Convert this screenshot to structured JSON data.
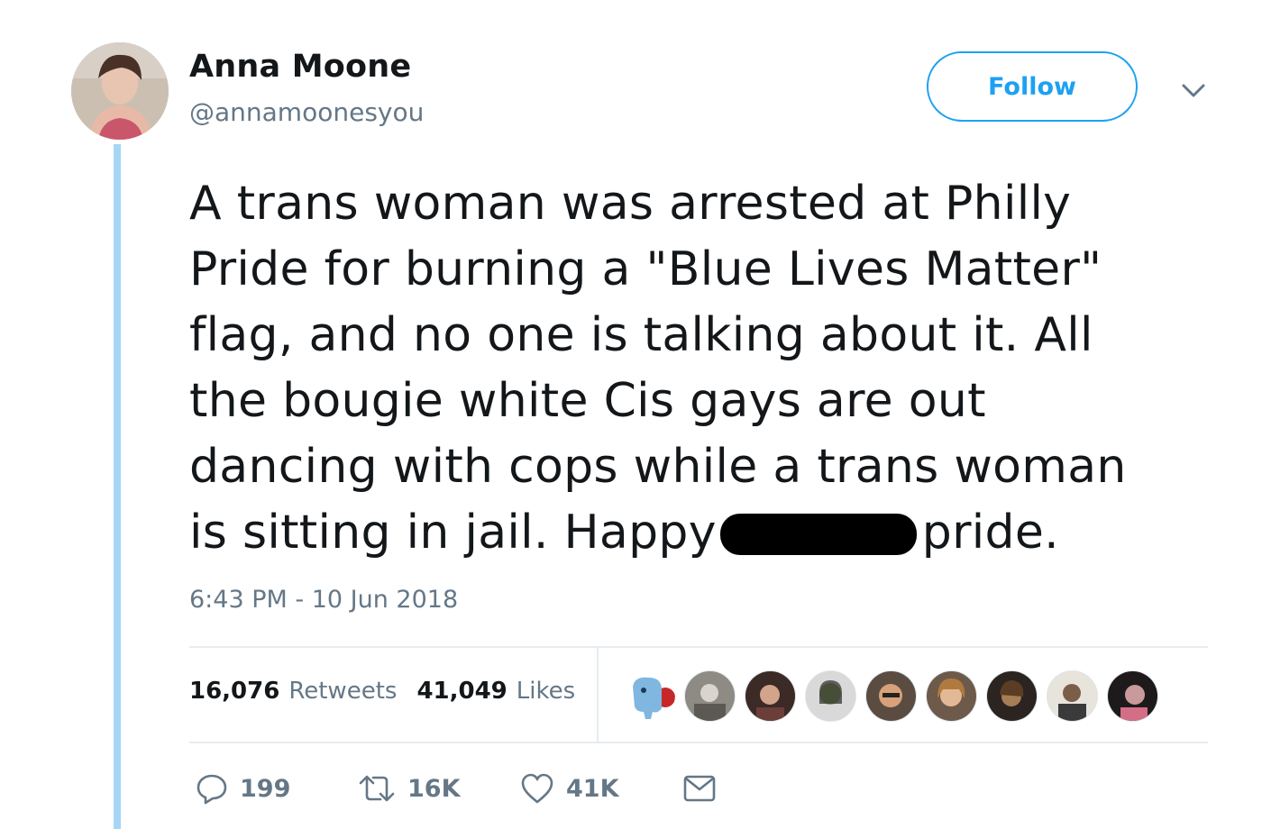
{
  "user": {
    "display_name": "Anna Moone",
    "handle": "@annamoonesyou"
  },
  "follow_label": "Follow",
  "tweet": {
    "lines": [
      "A trans woman was arrested at Philly",
      "Pride for burning a \"Blue Lives Matter\"",
      "flag, and no one is talking about it. All",
      "the bougie white Cis gays are out",
      "dancing with cops while a trans woman"
    ],
    "last_line_before": "is sitting in jail. Happy",
    "last_line_after": "pride.",
    "timestamp": "6:43 PM - 10 Jun 2018"
  },
  "stats": {
    "retweets_count": "16,076",
    "retweets_label": "Retweets",
    "likes_count": "41,049",
    "likes_label": "Likes"
  },
  "actions": {
    "reply_count": "199",
    "retweet_count": "16K",
    "like_count": "41K"
  },
  "colors": {
    "accent": "#1da1f2",
    "muted": "#657786",
    "thread_line": "#a6d6f5"
  }
}
